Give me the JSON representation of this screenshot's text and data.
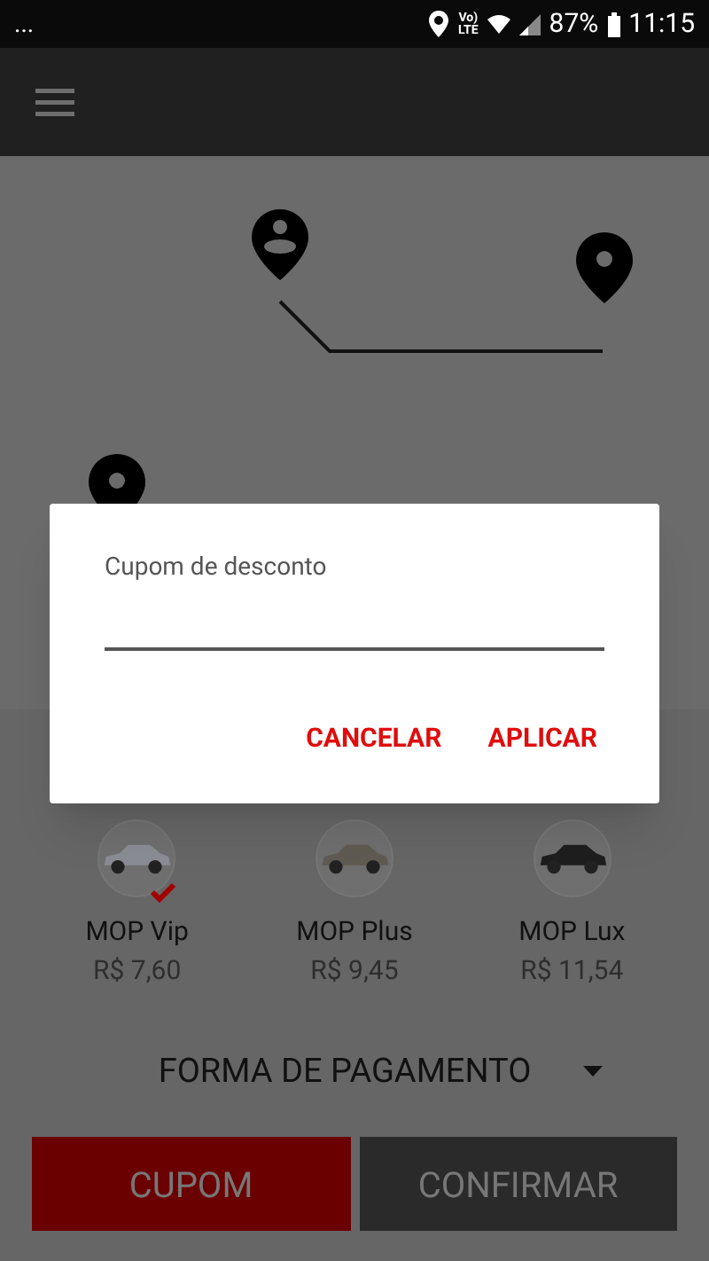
{
  "status_bar": {
    "notifications": "...",
    "volte_top": "Vo)",
    "volte_bottom": "LTE",
    "battery": "87%",
    "time": "11:15"
  },
  "dialog": {
    "label": "Cupom de desconto",
    "buttons": [
      "CANCELAR",
      "APLICAR"
    ]
  },
  "cars": [
    {
      "name": "MOP Vip",
      "price": "R$ 7,60",
      "selected": true
    },
    {
      "name": "MOP Plus",
      "price": "R$ 9,45",
      "selected": false
    },
    {
      "name": "MOP Lux",
      "price": "R$ 11,54",
      "selected": false
    }
  ],
  "payment": {
    "label": "FORMA DE PAGAMENTO"
  },
  "buttons": [
    {
      "label": "CUPOM",
      "kind": "primary"
    },
    {
      "label": "CONFIRMAR",
      "kind": "secondary"
    }
  ]
}
